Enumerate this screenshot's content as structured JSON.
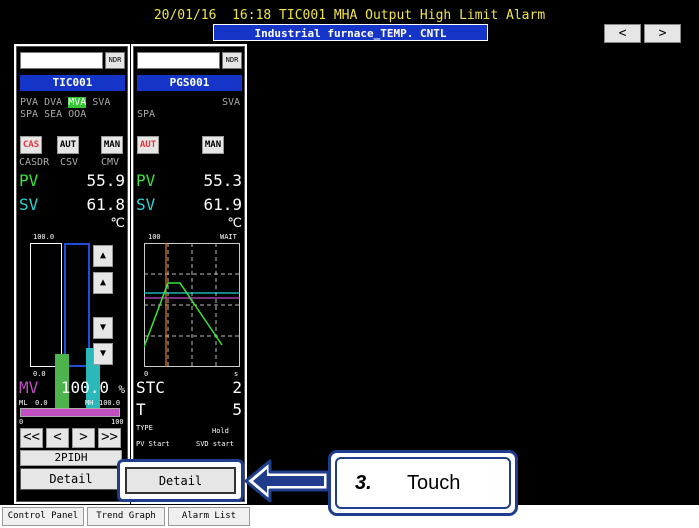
{
  "alarm_banner": "20/01/16  16:18 TIC001 MHA Output High Limit Alarm",
  "window_title": "Industrial furnace_TEMP. CNTL",
  "nav": {
    "prev": "<",
    "next": ">"
  },
  "fp1": {
    "ndr": "NDR",
    "tag": "TIC001",
    "alarms_row1": [
      "PVA",
      "DVA",
      "MVA",
      "SVA"
    ],
    "alarms_row2": "SPA SEA OOA",
    "modes": [
      "CAS",
      "AUT",
      "MAN"
    ],
    "mode_sub": [
      "CASDR",
      "CSV",
      "CMV"
    ],
    "pv_label": "PV",
    "pv_value": "55.9",
    "sv_label": "SV",
    "sv_value": "61.8",
    "unit": "℃",
    "bar_top": "100.0",
    "bar_bottom": "0.0",
    "pv_bar_fraction": 0.48,
    "sv_bar_fraction": 0.53,
    "mv_label": "MV",
    "mv_value": "100.0",
    "mv_unit": "%",
    "ml": "ML",
    "ml_value": "0.0",
    "mh": "MH",
    "mh_value": "100.0",
    "scale_min": "0",
    "scale_max": "100",
    "step_buttons": [
      "<<",
      "<",
      ">",
      ">>"
    ],
    "control_type": "2PIDH",
    "detail": "Detail"
  },
  "fp2": {
    "ndr": "NDR",
    "tag": "PGS001",
    "alarm_sva": "SVA",
    "spa": "SPA",
    "mode": "AUT",
    "mode2": "MAN",
    "pv_label": "PV",
    "pv_value": "55.3",
    "sv_label": "SV",
    "sv_value": "61.9",
    "unit": "℃",
    "graph_top": "100",
    "graph_wait": "WAIT",
    "graph_bottom": "0",
    "graph_right": "s",
    "stc_label": "STC",
    "stc_value": "2",
    "t_label": "T",
    "t_value": "5",
    "type_label": "TYPE",
    "type_value": "Hold",
    "pv_start": "PV Start",
    "svd_start": "SVD start",
    "detail": "Detail"
  },
  "tabs": [
    "Control Panel",
    "Trend Graph",
    "Alarm List"
  ],
  "callout": {
    "step": "3.",
    "text": "Touch"
  },
  "colors": {
    "pv": "#39e639",
    "sv": "#2bd4d4",
    "mv": "#c050c0",
    "alarm_text": "#f0e44a",
    "title_bg": "#1535c8",
    "cas": "#e8343f",
    "callout": "#1f3d8c"
  }
}
